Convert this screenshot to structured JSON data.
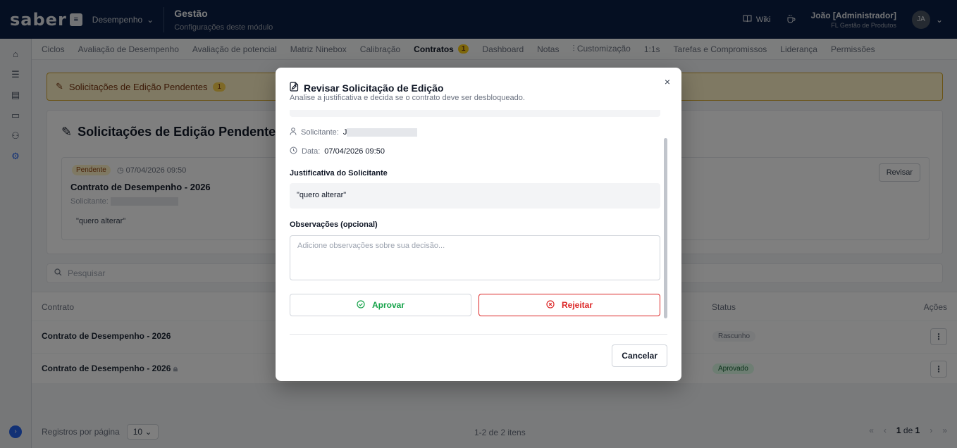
{
  "topbar": {
    "logo": "saber",
    "module": "Desempenho",
    "title": "Gestão",
    "subtitle": "Configurações deste módulo",
    "wiki": "Wiki",
    "user_name": "João [Administrador]",
    "user_role": "FL Gestão de Produtos",
    "avatar_initials": "JA"
  },
  "tabs": [
    {
      "label": "Ciclos"
    },
    {
      "label": "Avaliação de Desempenho"
    },
    {
      "label": "Avaliação de potencial"
    },
    {
      "label": "Matriz Ninebox"
    },
    {
      "label": "Calibração"
    },
    {
      "label": "Contratos",
      "badge": "1",
      "active": true
    },
    {
      "label": "Dashboard"
    },
    {
      "label": "Notas"
    },
    {
      "label": "Customização"
    },
    {
      "label": "1:1s"
    },
    {
      "label": "Tarefas e Compromissos"
    },
    {
      "label": "Liderança"
    },
    {
      "label": "Permissões"
    }
  ],
  "banner": {
    "label": "Solicitações de Edição Pendentes",
    "count": "1"
  },
  "pending": {
    "title": "Solicitações de Edição Pendentes",
    "card": {
      "status": "Pendente",
      "date": "07/04/2026 09:50",
      "title": "Contrato de Desempenho - 2026",
      "requester_label": "Solicitante:",
      "quote": "\"quero alterar\"",
      "review_button": "Revisar"
    }
  },
  "search": {
    "placeholder": "Pesquisar"
  },
  "table": {
    "headers": {
      "contract": "Contrato",
      "status": "Status",
      "actions": "Ações"
    },
    "rows": [
      {
        "name": "Contrato de Desempenho - 2026",
        "status": "Rascunho"
      },
      {
        "name": "Contrato de Desempenho - 2026",
        "status": "Aprovado"
      }
    ]
  },
  "footer": {
    "per_page_label": "Registros por página",
    "per_page_value": "10",
    "items": "1-2 de 2 itens",
    "page_current": "1",
    "page_of": "de",
    "page_total": "1"
  },
  "modal": {
    "title": "Revisar Solicitação de Edição",
    "subtitle": "Analise a justificativa e decida se o contrato deve ser desbloqueado.",
    "requester_label": "Solicitante:",
    "requester_initial": "J",
    "date_label": "Data:",
    "date_value": "07/04/2026 09:50",
    "justification_label": "Justificativa do Solicitante",
    "justification_text": "\"quero alterar\"",
    "notes_label": "Observações (opcional)",
    "notes_placeholder": "Adicione observações sobre sua decisão...",
    "approve": "Aprovar",
    "reject": "Rejeitar",
    "cancel": "Cancelar",
    "close": "×"
  }
}
